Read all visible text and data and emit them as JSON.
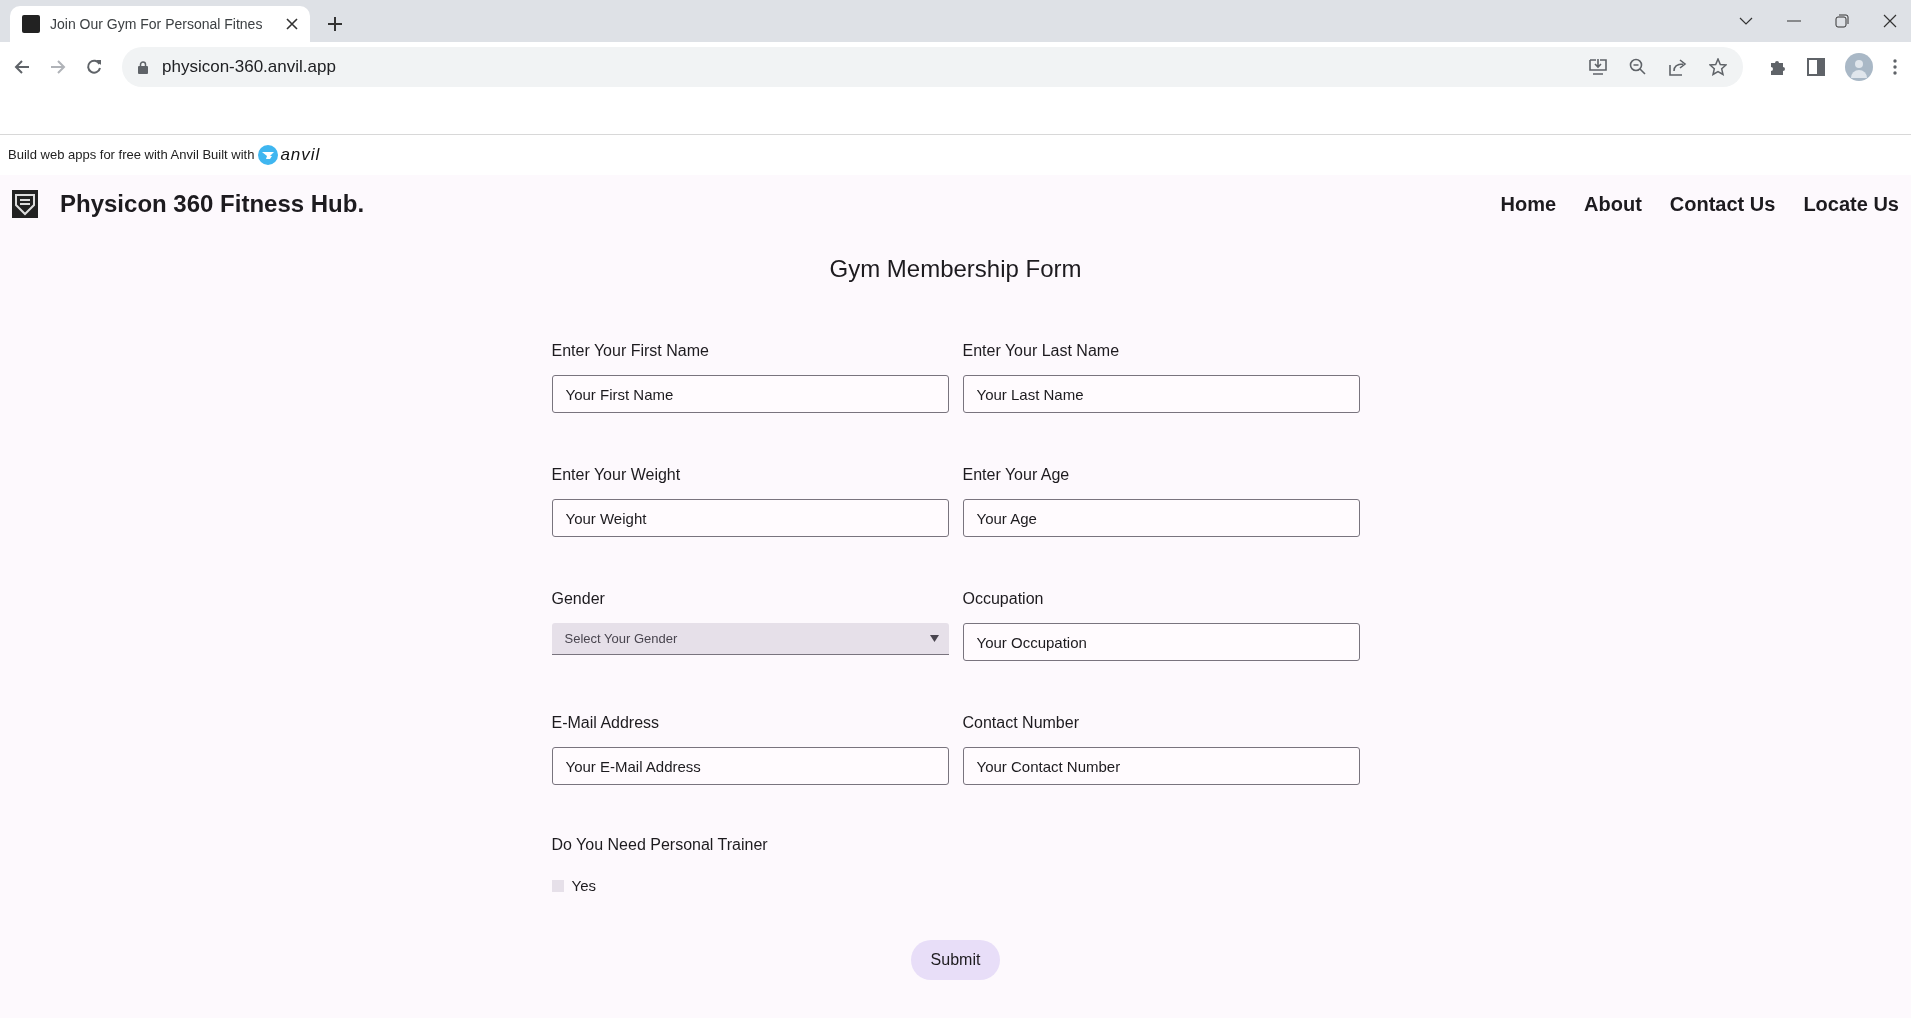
{
  "browser": {
    "tab": {
      "title": "Join Our Gym For Personal Fitnes"
    },
    "url": "physicon-360.anvil.app"
  },
  "banner": {
    "text": "Build web apps for free with Anvil Built with",
    "logo_text": "anvil"
  },
  "header": {
    "title": "Physicon 360 Fitness Hub.",
    "nav": [
      {
        "label": "Home"
      },
      {
        "label": "About"
      },
      {
        "label": "Contact Us"
      },
      {
        "label": "Locate Us"
      }
    ]
  },
  "form": {
    "title": "Gym Membership Form",
    "fields": [
      {
        "kind": "text",
        "label": "Enter Your First Name",
        "placeholder": "Your First Name"
      },
      {
        "kind": "text",
        "label": "Enter Your Last Name",
        "placeholder": "Your Last Name"
      },
      {
        "kind": "text",
        "label": "Enter Your Weight",
        "placeholder": "Your Weight"
      },
      {
        "kind": "text",
        "label": "Enter Your Age",
        "placeholder": "Your Age"
      },
      {
        "kind": "select",
        "label": "Gender",
        "placeholder": "Select Your Gender"
      },
      {
        "kind": "text",
        "label": "Occupation",
        "placeholder": "Your Occupation"
      },
      {
        "kind": "text",
        "label": "E-Mail Address",
        "placeholder": "Your E-Mail Address"
      },
      {
        "kind": "text",
        "label": "Contact Number",
        "placeholder": "Your Contact Number"
      }
    ],
    "trainer": {
      "label": "Do You Need Personal Trainer",
      "option": "Yes",
      "checked": false
    },
    "submit": "Submit"
  }
}
